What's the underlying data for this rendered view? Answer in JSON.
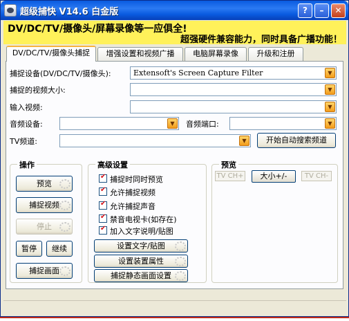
{
  "window": {
    "title": "超级捕快 V14.6 白金版",
    "buttons": {
      "help": "?",
      "minimize": "–",
      "maximize": "□",
      "close": "✕"
    }
  },
  "banner": {
    "line1": "DV/DC/TV/摄像头/屏幕录像等一应俱全!",
    "line2": "超强硬件兼容能力，同时具备广播功能！"
  },
  "tabs": [
    {
      "label": "DV/DC/TV/摄像头捕捉",
      "active": true
    },
    {
      "label": "增强设置和视频广播",
      "active": false
    },
    {
      "label": "电脑屏幕录像",
      "active": false
    },
    {
      "label": "升级和注册",
      "active": false
    }
  ],
  "form": {
    "capture_device_label": "捕捉设备(DV/DC/TV/摄像头):",
    "capture_device_value": "Extensoft's Screen Capture Filter",
    "video_size_label": "捕捉的视频大小:",
    "video_size_value": "",
    "input_video_label": "输入视频:",
    "input_video_value": "",
    "audio_device_label": "音频设备:",
    "audio_device_value": "",
    "audio_port_label": "音频端口:",
    "audio_port_value": "",
    "tv_channel_label": "TV频道:",
    "tv_channel_value": "",
    "auto_search_button": "开始自动搜索频道"
  },
  "operations": {
    "title": "操作",
    "preview": "预览",
    "capture_video": "捕捉视频",
    "stop": "停止",
    "pause": "暂停",
    "resume": "继续",
    "capture_frame": "捕捉画面"
  },
  "advanced": {
    "title": "高级设置",
    "checkboxes": [
      {
        "label": "捕捉时同时预览",
        "checked": true
      },
      {
        "label": "允许捕捉视频",
        "checked": true
      },
      {
        "label": "允许捕捉声音",
        "checked": true
      },
      {
        "label": "禁音电视卡(如存在)",
        "checked": true
      },
      {
        "label": "加入文字说明/贴图",
        "checked": true
      }
    ],
    "set_text_button": "设置文字/贴图",
    "device_props_button": "设置装置属性",
    "still_frame_button": "捕捉静态画面设置"
  },
  "preview": {
    "title": "预览",
    "tv_ch_plus": "TV CH+",
    "size_button": "大小+/-",
    "tv_ch_minus": "TV CH-"
  },
  "colors": {
    "banner_bg": "#fff15a",
    "title_bar": "#0a5be0",
    "checkmark": "#d7141a",
    "combo_arrow": "#f39c1a"
  }
}
